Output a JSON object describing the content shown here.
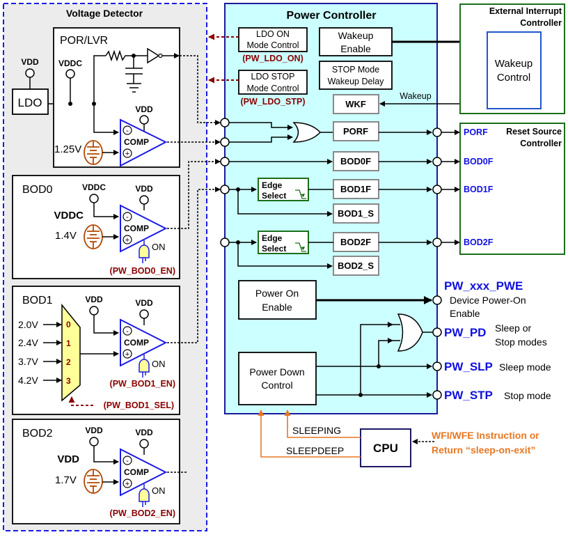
{
  "voltage_detector": {
    "title": "Voltage Detector",
    "ldo_label": "LDO",
    "vdd": "VDD",
    "vddc": "VDDC",
    "comp": "COMP",
    "on": "ON",
    "minus": "-",
    "plus": "+",
    "por_lvr": {
      "title": "POR/LVR",
      "ref": "1.25V"
    },
    "bod0": {
      "title": "BOD0",
      "source": "VDDC",
      "ref": "1.4V",
      "enable": "(PW_BOD0_EN)"
    },
    "bod1": {
      "title": "BOD1",
      "inputs": [
        "2.0V",
        "2.4V",
        "3.7V",
        "4.2V"
      ],
      "mux_indices": [
        "0",
        "1",
        "2",
        "3"
      ],
      "enable": "(PW_BOD1_EN)",
      "select": "(PW_BOD1_SEL)"
    },
    "bod2": {
      "title": "BOD2",
      "source": "VDD",
      "ref": "1.7V",
      "enable": "(PW_BOD2_EN)"
    }
  },
  "power_controller": {
    "title": "Power Controller",
    "ldo_on": {
      "line1": "LDO ON",
      "line2": "Mode Control",
      "signal": "(PW_LDO_ON)"
    },
    "ldo_stop": {
      "line1": "LDO STOP",
      "line2": "Mode Control",
      "signal": "(PW_LDO_STP)"
    },
    "wakeup_enable": {
      "line1": "Wakeup",
      "line2": "Enable"
    },
    "stop_delay": {
      "line1": "STOP Mode",
      "line2": "Wakeup Delay"
    },
    "wkf": "WKF",
    "wakeup_label": "Wakeup",
    "flags": [
      "PORF",
      "BOD0F",
      "BOD1F",
      "BOD1_S",
      "BOD2F",
      "BOD2_S"
    ],
    "edge_select": {
      "line1": "Edge",
      "line2": "Select"
    },
    "power_on_enable": {
      "line1": "Power On",
      "line2": "Enable"
    },
    "power_down_control": {
      "line1": "Power Down",
      "line2": "Control"
    }
  },
  "outputs": {
    "pwe": {
      "name": "PW_xxx_PWE",
      "desc1": "Device Power-On",
      "desc2": "Enable"
    },
    "pd": {
      "name": "PW_PD",
      "desc1": "Sleep or",
      "desc2": "Stop modes"
    },
    "slp": {
      "name": "PW_SLP",
      "desc": "Sleep mode"
    },
    "stp": {
      "name": "PW_STP",
      "desc": "Stop mode"
    }
  },
  "external_interrupt": {
    "title1": "External Interrupt",
    "title2": "Controller",
    "wakeup_control": {
      "line1": "Wakeup",
      "line2": "Control"
    }
  },
  "reset_source": {
    "title1": "Reset Source",
    "title2": "Controller",
    "signals": [
      "PORF",
      "BOD0F",
      "BOD1F",
      "BOD2F"
    ]
  },
  "cpu": {
    "label": "CPU",
    "sleeping": "SLEEPING",
    "sleepdeep": "SLEEPDEEP",
    "trigger1": "WFI/WFE Instruction or",
    "trigger2": "Return “sleep-on-exit”"
  },
  "colors": {
    "voltage_detector_border": "#1a1ae6",
    "power_controller_fill": "#ccffff",
    "signal_blue": "#1010e0",
    "enable_red": "#8b0000",
    "cpu_orange": "#e87722",
    "controller_green": "#1a6e1a"
  }
}
